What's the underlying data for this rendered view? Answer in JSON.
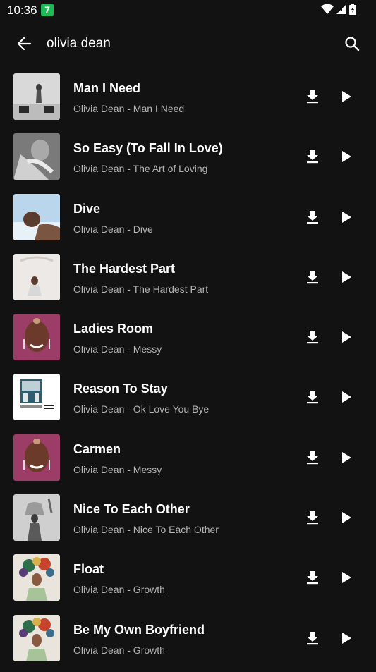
{
  "status_bar": {
    "time": "10:36",
    "badge": "7"
  },
  "search": {
    "query": "olivia dean"
  },
  "songs": [
    {
      "title": "Man I Need",
      "subtitle": "Olivia Dean - Man I Need",
      "art": "man-i-need"
    },
    {
      "title": "So Easy (To Fall In Love)",
      "subtitle": "Olivia Dean - The Art of Loving",
      "art": "art-of-loving"
    },
    {
      "title": "Dive",
      "subtitle": "Olivia Dean - Dive",
      "art": "dive"
    },
    {
      "title": "The Hardest Part",
      "subtitle": "Olivia Dean - The Hardest Part",
      "art": "hardest-part"
    },
    {
      "title": "Ladies Room",
      "subtitle": "Olivia Dean - Messy",
      "art": "messy"
    },
    {
      "title": "Reason To Stay",
      "subtitle": "Olivia Dean - Ok Love You Bye",
      "art": "ok-love-you-bye"
    },
    {
      "title": "Carmen",
      "subtitle": "Olivia Dean - Messy",
      "art": "messy"
    },
    {
      "title": "Nice To Each Other",
      "subtitle": "Olivia Dean - Nice To Each Other",
      "art": "nice-to-each-other"
    },
    {
      "title": "Float",
      "subtitle": "Olivia Dean - Growth",
      "art": "growth"
    },
    {
      "title": "Be My Own Boyfriend",
      "subtitle": "Olivia Dean - Growth",
      "art": "growth"
    }
  ]
}
